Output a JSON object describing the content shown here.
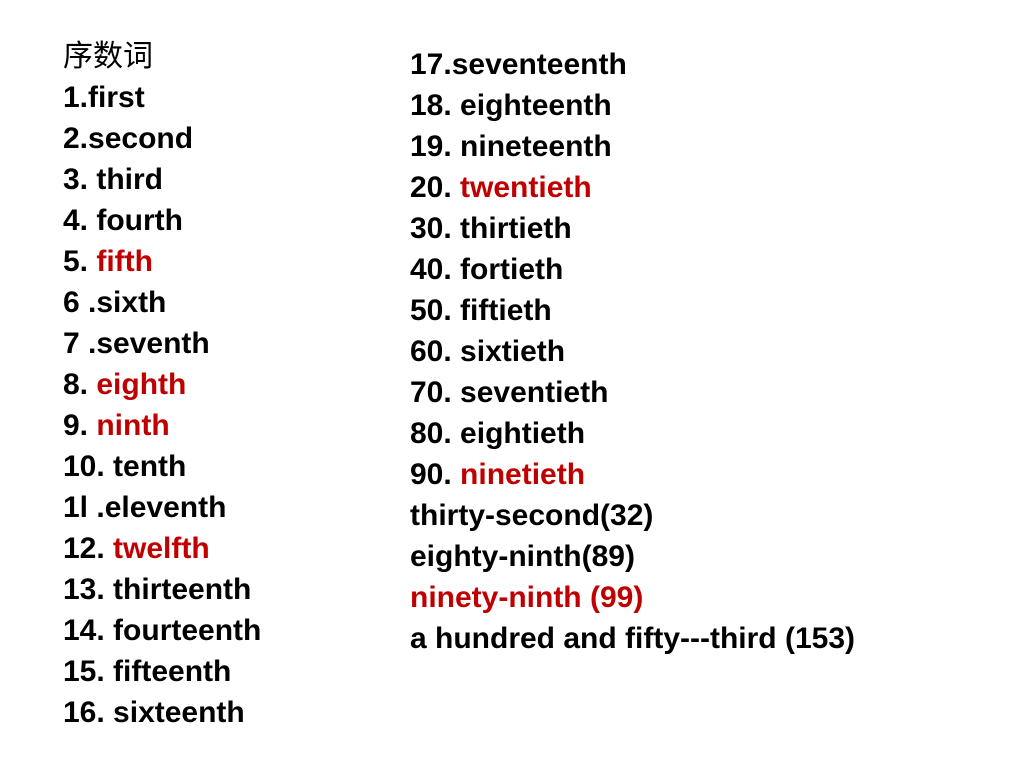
{
  "accent_color": "#c00000",
  "title": "序数词",
  "left_column": [
    {
      "num": "1.",
      "word": "first",
      "red": false
    },
    {
      "num": "2.",
      "word": "second",
      "red": false
    },
    {
      "num": "3. ",
      "word": "third",
      "red": false
    },
    {
      "num": "4. ",
      "word": "fourth",
      "red": false
    },
    {
      "num": "5. ",
      "word": "fifth",
      "red": true
    },
    {
      "num": "6 .",
      "word": "sixth",
      "red": false
    },
    {
      "num": "7 .",
      "word": "seventh",
      "red": false
    },
    {
      "num": "8. ",
      "word": "eighth",
      "red": true
    },
    {
      "num": "9. ",
      "word": "ninth",
      "red": true
    },
    {
      "num": "10. ",
      "word": "tenth",
      "red": false
    },
    {
      "num": "1l .",
      "word": "eleventh",
      "red": false
    },
    {
      "num": "12. ",
      "word": "twelfth",
      "red": true
    },
    {
      "num": "13. ",
      "word": "thirteenth",
      "red": false
    },
    {
      "num": "14. ",
      "word": "fourteenth",
      "red": false
    },
    {
      "num": "15. ",
      "word": "fifteenth",
      "red": false
    },
    {
      "num": "16. ",
      "word": "sixteenth",
      "red": false
    }
  ],
  "right_column": [
    {
      "num": "17.",
      "word": "seventeenth",
      "red": false
    },
    {
      "num": "18. ",
      "word": "eighteenth",
      "red": false
    },
    {
      "num": "19. ",
      "word": "nineteenth",
      "red": false
    },
    {
      "num": "20. ",
      "word": "twentieth",
      "red": true
    },
    {
      "num": "30. ",
      "word": "thirtieth",
      "red": false
    },
    {
      "num": "40. ",
      "word": "fortieth",
      "red": false
    },
    {
      "num": "50. ",
      "word": "fiftieth",
      "red": false
    },
    {
      "num": "60. ",
      "word": "sixtieth",
      "red": false
    },
    {
      "num": "70. ",
      "word": "seventieth",
      "red": false
    },
    {
      "num": "80. ",
      "word": "eightieth",
      "red": false
    },
    {
      "num": "90. ",
      "word": "ninetieth",
      "red": true
    },
    {
      "num": "",
      "word": "thirty-second(32)",
      "red": false
    },
    {
      "num": "",
      "word": "eighty-ninth(89)",
      "red": false
    },
    {
      "num": "",
      "word": "ninety-ninth (99)",
      "red": true
    },
    {
      "num": "",
      "word": "a hundred and fifty---third (153)",
      "red": false
    }
  ]
}
